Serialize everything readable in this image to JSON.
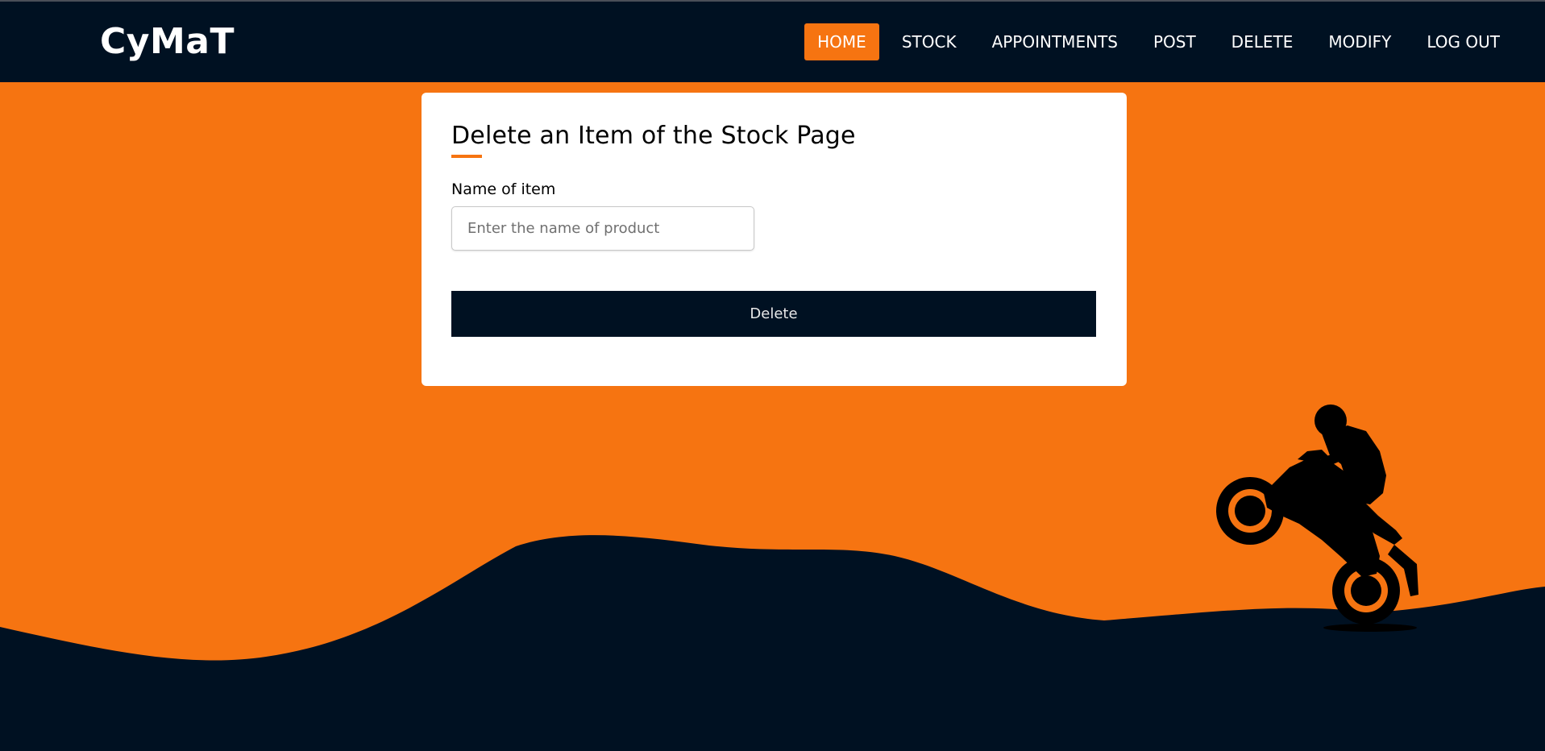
{
  "brand": {
    "logo_text": "CyMaT"
  },
  "nav": {
    "items": [
      {
        "label": "HOME",
        "active": true
      },
      {
        "label": "STOCK",
        "active": false
      },
      {
        "label": "APPOINTMENTS",
        "active": false
      },
      {
        "label": "POST",
        "active": false
      },
      {
        "label": "DELETE",
        "active": false
      },
      {
        "label": "MODIFY",
        "active": false
      },
      {
        "label": "LOG OUT",
        "active": false
      }
    ]
  },
  "form": {
    "title": "Delete an Item of the Stock Page",
    "name_label": "Name of item",
    "name_placeholder": "Enter the name of product",
    "name_value": "",
    "submit_label": "Delete"
  },
  "theme": {
    "accent": "#f67411",
    "dark": "#001122",
    "card_bg": "#ffffff"
  },
  "illustration": {
    "icon": "motorcycle-rider-wheelie-silhouette"
  }
}
